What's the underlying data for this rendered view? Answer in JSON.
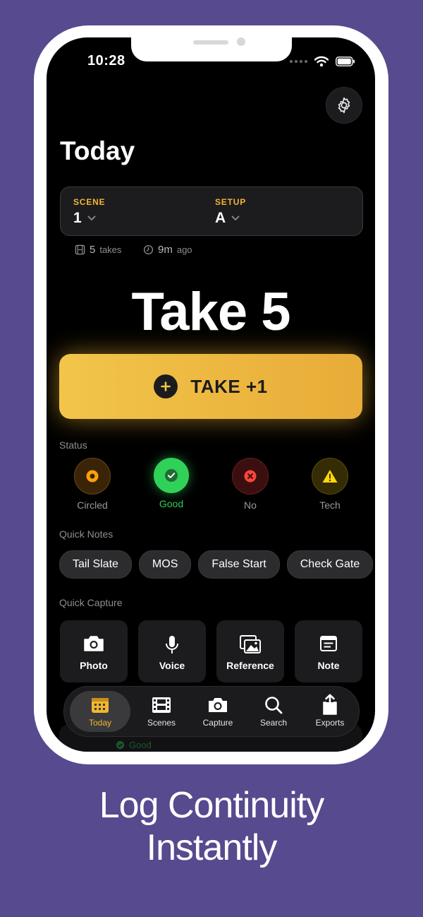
{
  "status_bar": {
    "time": "10:28"
  },
  "header": {
    "title": "Today"
  },
  "scene_card": {
    "scene_label": "SCENE",
    "scene_value": "1",
    "setup_label": "SETUP",
    "setup_value": "A"
  },
  "meta": {
    "takes_count": "5",
    "takes_label": "takes",
    "elapsed": "9m",
    "elapsed_label": "ago"
  },
  "take": {
    "display": "Take 5",
    "button_label": "TAKE +1"
  },
  "status": {
    "label": "Status",
    "items": [
      {
        "label": "Circled",
        "color": "#ff9f0a"
      },
      {
        "label": "Good",
        "color": "#30d158"
      },
      {
        "label": "No",
        "color": "#ff453a"
      },
      {
        "label": "Tech",
        "color": "#ffd60a"
      }
    ]
  },
  "quick_notes": {
    "label": "Quick Notes",
    "items": [
      "Tail Slate",
      "MOS",
      "False Start",
      "Check Gate"
    ]
  },
  "quick_capture": {
    "label": "Quick Capture",
    "items": [
      "Photo",
      "Voice",
      "Reference",
      "Note"
    ]
  },
  "behind": {
    "good": "Good"
  },
  "tabbar": {
    "items": [
      "Today",
      "Scenes",
      "Capture",
      "Search",
      "Exports"
    ],
    "active": "Today"
  },
  "tagline": {
    "line1": "Log Continuity",
    "line2": "Instantly"
  },
  "colors": {
    "background": "#574a8e",
    "accent": "#f2b630"
  }
}
